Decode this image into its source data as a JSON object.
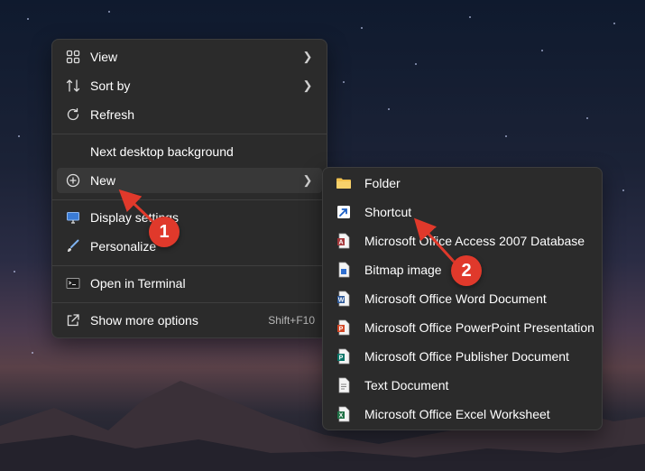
{
  "context_menu": {
    "items": [
      {
        "label": "View",
        "icon": "grid-icon"
      },
      {
        "label": "Sort by",
        "icon": "sort-icon"
      },
      {
        "label": "Refresh",
        "icon": "refresh-icon"
      },
      {
        "label": "Next desktop background"
      },
      {
        "label": "New",
        "icon": "plus-circle-icon"
      },
      {
        "label": "Display settings",
        "icon": "display-icon"
      },
      {
        "label": "Personalize",
        "icon": "brush-icon"
      },
      {
        "label": "Open in Terminal",
        "icon": "terminal-icon"
      },
      {
        "label": "Show more options",
        "icon": "share-icon",
        "shortcut": "Shift+F10"
      }
    ]
  },
  "new_submenu": {
    "items": [
      {
        "label": "Folder",
        "icon": "folder-icon"
      },
      {
        "label": "Shortcut",
        "icon": "shortcut-icon"
      },
      {
        "label": "Microsoft Office Access 2007 Database",
        "icon": "access-file-icon"
      },
      {
        "label": "Bitmap image",
        "icon": "bitmap-file-icon"
      },
      {
        "label": "Microsoft Office Word Document",
        "icon": "word-file-icon"
      },
      {
        "label": "Microsoft Office PowerPoint Presentation",
        "icon": "powerpoint-file-icon"
      },
      {
        "label": "Microsoft Office Publisher Document",
        "icon": "publisher-file-icon"
      },
      {
        "label": "Text Document",
        "icon": "text-file-icon"
      },
      {
        "label": "Microsoft Office Excel Worksheet",
        "icon": "excel-file-icon"
      }
    ]
  },
  "annotations": {
    "step1": "1",
    "step2": "2",
    "color": "#e0392b"
  }
}
